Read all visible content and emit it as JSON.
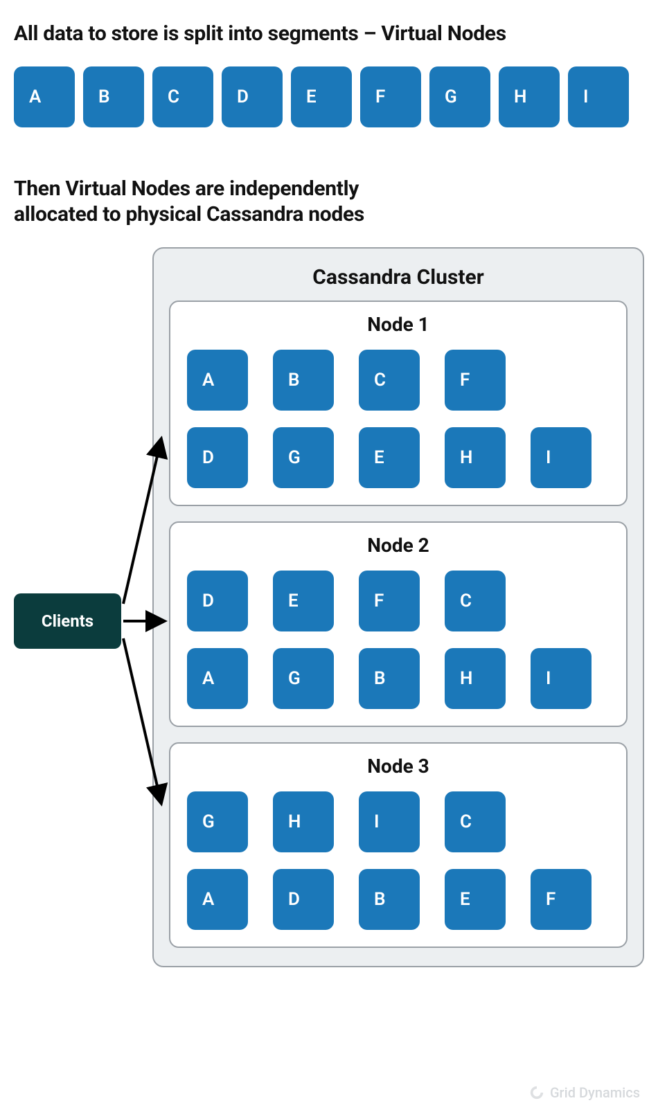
{
  "heading1": "All data to store is split into segments – Virtual Nodes",
  "virtual_nodes": [
    "A",
    "B",
    "C",
    "D",
    "E",
    "F",
    "G",
    "H",
    "I"
  ],
  "heading2_line1": "Then Virtual Nodes are independently",
  "heading2_line2": "allocated to physical Cassandra nodes",
  "clients_label": "Clients",
  "cluster_title": "Cassandra Cluster",
  "nodes": [
    {
      "title": "Node 1",
      "tiles": [
        "A",
        "B",
        "C",
        "F",
        "D",
        "G",
        "E",
        "H",
        "I"
      ]
    },
    {
      "title": "Node 2",
      "tiles": [
        "D",
        "E",
        "F",
        "C",
        "A",
        "G",
        "B",
        "H",
        "I"
      ]
    },
    {
      "title": "Node 3",
      "tiles": [
        "G",
        "H",
        "I",
        "C",
        "A",
        "D",
        "B",
        "E",
        "F"
      ]
    }
  ],
  "watermark": "Grid Dynamics"
}
